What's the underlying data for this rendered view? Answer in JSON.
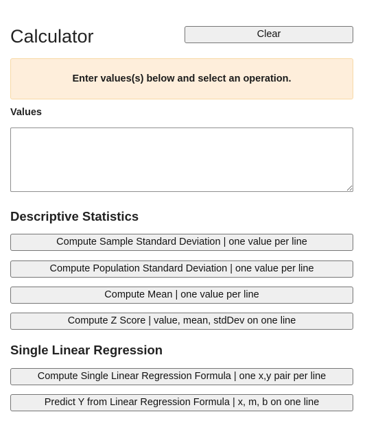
{
  "app": {
    "title": "Calculator",
    "clear_label": "Clear"
  },
  "notice": {
    "text": "Enter values(s) below and select an operation."
  },
  "values": {
    "label": "Values",
    "value": "",
    "placeholder": ""
  },
  "descriptive": {
    "heading": "Descriptive Statistics",
    "buttons": [
      "Compute Sample Standard Deviation | one value per line",
      "Compute Population Standard Deviation | one value per line",
      "Compute Mean | one value per line",
      "Compute Z Score | value, mean, stdDev on one line"
    ]
  },
  "regression": {
    "heading": "Single Linear Regression",
    "buttons": [
      "Compute Single Linear Regression Formula | one x,y pair per line",
      "Predict Y from Linear Regression Formula | x, m, b on one line"
    ]
  },
  "colors": {
    "notice_bg": "#feeedb",
    "notice_border": "#f7d9a6",
    "button_bg": "#efefef",
    "button_border": "#767676"
  }
}
